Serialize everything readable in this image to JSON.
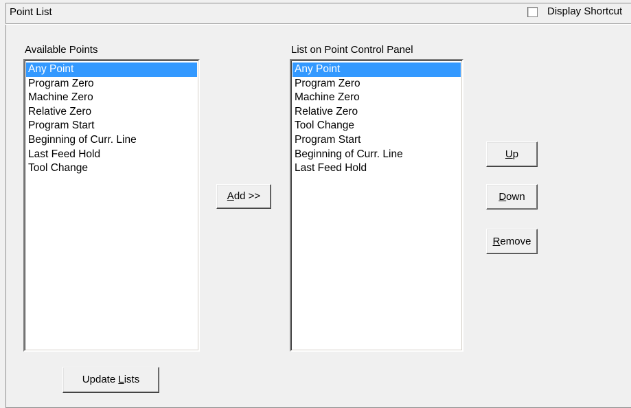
{
  "group": {
    "title": "Point List",
    "display_shortcut_label": "Display Shortcut",
    "display_shortcut_checked": false
  },
  "available": {
    "label": "Available Points",
    "selected_index": 0,
    "items": [
      "Any Point",
      "Program Zero",
      "Machine Zero",
      "Relative Zero",
      "Program Start",
      "Beginning of Curr. Line",
      "Last Feed Hold",
      "Tool Change"
    ]
  },
  "panel": {
    "label": "List on Point Control Panel",
    "selected_index": 0,
    "items": [
      "Any Point",
      "Program Zero",
      "Machine Zero",
      "Relative Zero",
      "Tool Change",
      "Program Start",
      "Beginning of Curr. Line",
      "Last Feed Hold"
    ]
  },
  "buttons": {
    "add": {
      "mnemonic": "A",
      "rest": "dd >>"
    },
    "up": {
      "mnemonic": "U",
      "rest": "p"
    },
    "down": {
      "mnemonic": "D",
      "rest": "own"
    },
    "remove": {
      "mnemonic": "R",
      "rest": "emove"
    },
    "update": {
      "pre": "Update ",
      "mnemonic": "L",
      "rest": "ists"
    }
  }
}
